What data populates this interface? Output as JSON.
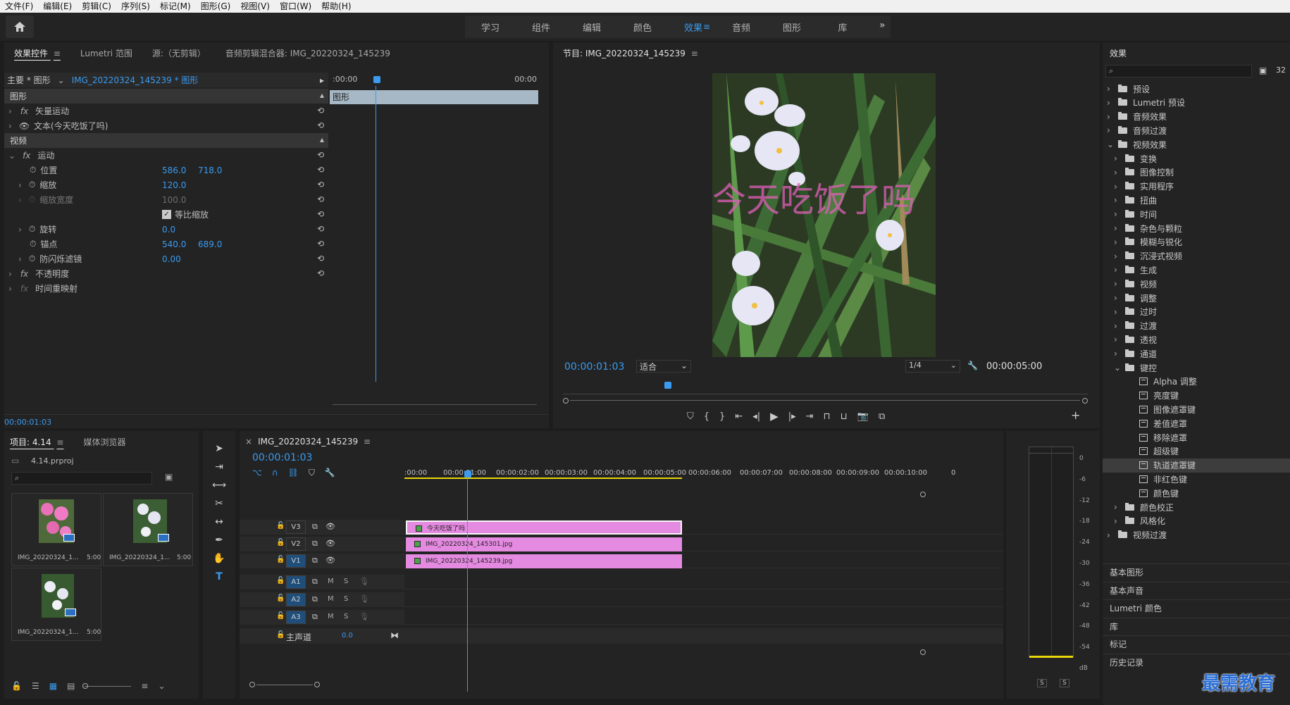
{
  "menu": [
    "文件(F)",
    "编辑(E)",
    "剪辑(C)",
    "序列(S)",
    "标记(M)",
    "图形(G)",
    "视图(V)",
    "窗口(W)",
    "帮助(H)"
  ],
  "workspaces": {
    "tabs": [
      "学习",
      "组件",
      "编辑",
      "颜色",
      "效果",
      "音频",
      "图形",
      "库"
    ],
    "active": "效果",
    "overflow": "»"
  },
  "effect_controls": {
    "tabs": [
      "效果控件",
      "Lumetri 范围",
      "源:（无剪辑）",
      "音频剪辑混合器: IMG_20220324_145239"
    ],
    "master": "主要 * 图形",
    "clip": "IMG_20220324_145239 * 图形",
    "time_start": ":00:00",
    "time_end": "00:00",
    "graphic_bar": "图形",
    "section_graphic": "图形",
    "vector_motion": "矢量运动",
    "text_layer": "文本(今天吃饭了吗)",
    "section_video": "视频",
    "motion": "运动",
    "position": {
      "label": "位置",
      "x": "586.0",
      "y": "718.0"
    },
    "scale": {
      "label": "缩放",
      "value": "120.0"
    },
    "scale_width": {
      "label": "缩放宽度",
      "value": "100.0"
    },
    "uniform_scale": "等比缩放",
    "rotation": {
      "label": "旋转",
      "value": "0.0"
    },
    "anchor": {
      "label": "锚点",
      "x": "540.0",
      "y": "689.0"
    },
    "flicker": {
      "label": "防闪烁滤镜",
      "value": "0.00"
    },
    "opacity": "不透明度",
    "time_remap": "时间重映射",
    "fx": "fx",
    "timecode": "00:00:01:03"
  },
  "program": {
    "title": "节目: IMG_20220324_145239",
    "overlay_text": "今天吃饭了吗",
    "timecode": "00:00:01:03",
    "fit": "适合",
    "resolution": "1/4",
    "duration": "00:00:05:00"
  },
  "effects": {
    "title": "效果",
    "items": [
      {
        "label": "预设",
        "level": 0,
        "open": false,
        "kind": "preset"
      },
      {
        "label": "Lumetri 预设",
        "level": 0,
        "open": false,
        "kind": "preset"
      },
      {
        "label": "音频效果",
        "level": 0,
        "open": false,
        "kind": "folder"
      },
      {
        "label": "音频过渡",
        "level": 0,
        "open": false,
        "kind": "folder"
      },
      {
        "label": "视频效果",
        "level": 0,
        "open": true,
        "kind": "folder"
      },
      {
        "label": "变换",
        "level": 1,
        "open": false,
        "kind": "folder"
      },
      {
        "label": "图像控制",
        "level": 1,
        "open": false,
        "kind": "folder"
      },
      {
        "label": "实用程序",
        "level": 1,
        "open": false,
        "kind": "folder"
      },
      {
        "label": "扭曲",
        "level": 1,
        "open": false,
        "kind": "folder"
      },
      {
        "label": "时间",
        "level": 1,
        "open": false,
        "kind": "folder"
      },
      {
        "label": "杂色与颗粒",
        "level": 1,
        "open": false,
        "kind": "folder"
      },
      {
        "label": "模糊与锐化",
        "level": 1,
        "open": false,
        "kind": "folder"
      },
      {
        "label": "沉浸式视频",
        "level": 1,
        "open": false,
        "kind": "folder"
      },
      {
        "label": "生成",
        "level": 1,
        "open": false,
        "kind": "folder"
      },
      {
        "label": "视频",
        "level": 1,
        "open": false,
        "kind": "folder"
      },
      {
        "label": "调整",
        "level": 1,
        "open": false,
        "kind": "folder"
      },
      {
        "label": "过时",
        "level": 1,
        "open": false,
        "kind": "folder"
      },
      {
        "label": "过渡",
        "level": 1,
        "open": false,
        "kind": "folder"
      },
      {
        "label": "透视",
        "level": 1,
        "open": false,
        "kind": "folder"
      },
      {
        "label": "通道",
        "level": 1,
        "open": false,
        "kind": "folder"
      },
      {
        "label": "键控",
        "level": 1,
        "open": true,
        "kind": "folder"
      },
      {
        "label": "Alpha 调整",
        "level": 2,
        "kind": "fx"
      },
      {
        "label": "亮度键",
        "level": 2,
        "kind": "fx"
      },
      {
        "label": "图像遮罩键",
        "level": 2,
        "kind": "fx"
      },
      {
        "label": "差值遮罩",
        "level": 2,
        "kind": "fx"
      },
      {
        "label": "移除遮罩",
        "level": 2,
        "kind": "fx"
      },
      {
        "label": "超级键",
        "level": 2,
        "kind": "fx"
      },
      {
        "label": "轨道遮罩键",
        "level": 2,
        "kind": "fx",
        "selected": true
      },
      {
        "label": "非红色键",
        "level": 2,
        "kind": "fx"
      },
      {
        "label": "颜色键",
        "level": 2,
        "kind": "fx"
      },
      {
        "label": "颜色校正",
        "level": 1,
        "open": false,
        "kind": "folder"
      },
      {
        "label": "风格化",
        "level": 1,
        "open": false,
        "kind": "folder"
      },
      {
        "label": "视频过渡",
        "level": 0,
        "open": false,
        "kind": "folder"
      }
    ],
    "collapsed_panels": [
      "基本图形",
      "基本声音",
      "Lumetri 颜色",
      "库",
      "标记",
      "历史记录"
    ]
  },
  "project": {
    "tabs": [
      "项目: 4.14",
      "媒体浏览器"
    ],
    "file": "4.14.prproj",
    "items": [
      {
        "name": "IMG_20220324_1...",
        "duration": "5:00"
      },
      {
        "name": "IMG_20220324_1...",
        "duration": "5:00"
      },
      {
        "name": "IMG_20220324_1...",
        "duration": "5:00"
      }
    ]
  },
  "timeline": {
    "title": "IMG_20220324_145239",
    "timecode": "00:00:01:03",
    "ruler": [
      ":00:00",
      "00:00:01:00",
      "00:00:02:00",
      "00:00:03:00",
      "00:00:04:00",
      "00:00:05:00",
      "00:00:06:00",
      "00:00:07:00",
      "00:00:08:00",
      "00:00:09:00",
      "00:00:10:00",
      "0"
    ],
    "video_tracks": [
      "V3",
      "V2",
      "V1"
    ],
    "audio_tracks": [
      "A1",
      "A2",
      "A3"
    ],
    "master": "主声道",
    "master_value": "0.0",
    "clips": [
      {
        "track": "V3",
        "name": "今天吃饭了吗"
      },
      {
        "track": "V2",
        "name": "IMG_20220324_145301.jpg"
      },
      {
        "track": "V1",
        "name": "IMG_20220324_145239.jpg"
      }
    ],
    "m": "M",
    "s": "S"
  },
  "meter": {
    "labels": [
      "0",
      "-6",
      "-12",
      "-18",
      "-24",
      "-30",
      "-36",
      "-42",
      "-48",
      "-54",
      "dB"
    ],
    "solo": [
      "S",
      "S"
    ]
  },
  "watermark": "最需教育",
  "colors": {
    "accent": "#3a9bf0",
    "clip": "#e58ae1",
    "panel": "#232323"
  }
}
